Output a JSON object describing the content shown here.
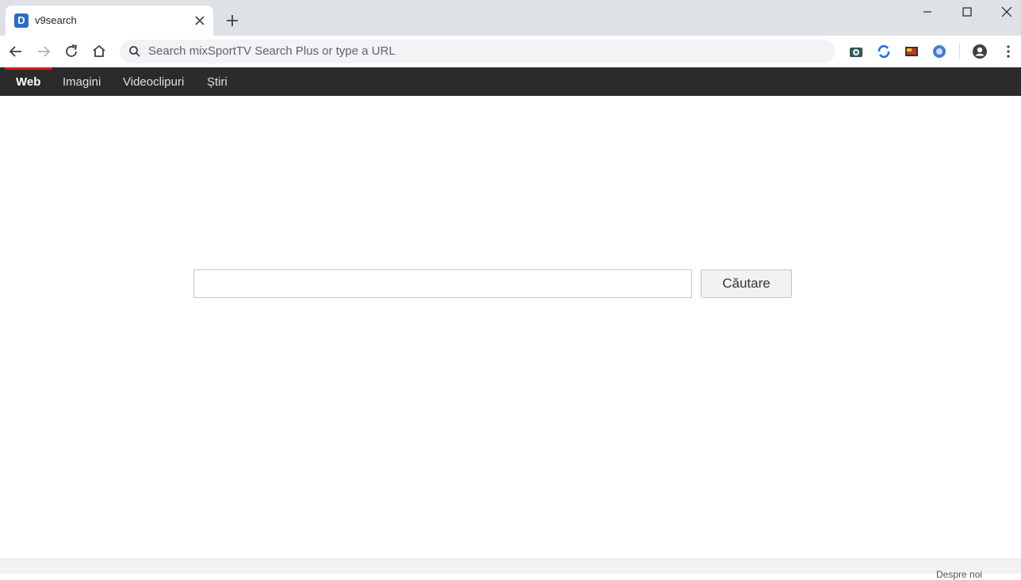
{
  "browser": {
    "tab": {
      "title": "v9search",
      "favicon_letter": "D"
    },
    "omnibox": {
      "placeholder": "Search mixSportTV Search Plus or type a URL"
    },
    "colors": {
      "tabstrip": "#dee1e6",
      "omnibox": "#f1f3f4"
    },
    "extensions": [
      "camera-extension-icon",
      "sync-extension-icon",
      "tv-extension-icon",
      "globe-extension-icon"
    ]
  },
  "nav": {
    "items": [
      {
        "label": "Web",
        "active": true
      },
      {
        "label": "Imagini",
        "active": false
      },
      {
        "label": "Videoclipuri",
        "active": false
      },
      {
        "label": "Știri",
        "active": false
      }
    ],
    "colors": {
      "bar": "#2b2b2b",
      "indicator": "#d31f1f"
    }
  },
  "search": {
    "value": "",
    "button_label": "Căutare"
  },
  "footer": {
    "text": "Despre noi"
  }
}
